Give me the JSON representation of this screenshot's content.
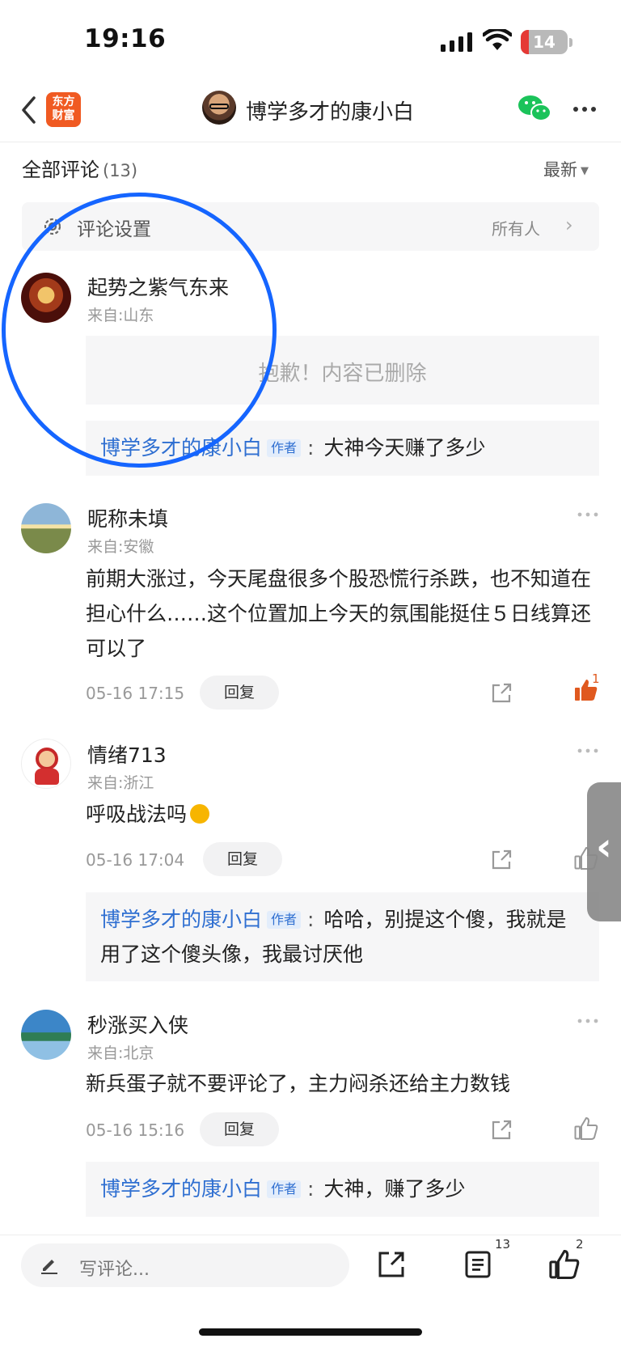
{
  "status_bar": {
    "time": "19:16",
    "battery": "14"
  },
  "nav": {
    "app_logo": "东方\n财富",
    "title": "博学多才的康小白",
    "back_icon": "chevron-left-icon",
    "share_icon": "wechat-icon",
    "more_icon": "more-icon"
  },
  "section": {
    "title": "全部评论",
    "count": "(13)",
    "sort": "最新"
  },
  "settings": {
    "label": "评论设置",
    "value": "所有人"
  },
  "comments": [
    {
      "name": "起势之紫气东来",
      "location": "来自:山东",
      "deleted_text": "抱歉！内容已删除",
      "reply": {
        "author": "博学多才的康小白",
        "tag": "作者",
        "colon": ":",
        "text": "大神今天赚了多少"
      }
    },
    {
      "name": "昵称未填",
      "location": "来自:安徽",
      "content": "前期大涨过，今天尾盘很多个股恐慌行杀跌，也不知道在担心什么……这个位置加上今天的氛围能挺住５日线算还可以了",
      "time": "05-16 17:15",
      "reply_label": "回复",
      "like_count": "1"
    },
    {
      "name": "情绪713",
      "location": "来自:浙江",
      "content": "呼吸战法吗",
      "time": "05-16 17:04",
      "reply_label": "回复",
      "reply": {
        "author": "博学多才的康小白",
        "tag": "作者",
        "colon": ":",
        "text": "哈哈，别提这个傻，我就是用了这个傻头像，我最讨厌他"
      }
    },
    {
      "name": "秒涨买入侠",
      "location": "来自:北京",
      "content": "新兵蛋子就不要评论了，主力闷杀还给主力数钱",
      "time": "05-16 15:16",
      "reply_label": "回复",
      "reply": {
        "author": "博学多才的康小白",
        "tag": "作者",
        "colon": ":",
        "text": "大神，赚了多少"
      }
    }
  ],
  "bottom_bar": {
    "placeholder": "写评论...",
    "comment_count": "13",
    "like_count": "2"
  },
  "colors": {
    "accent_blue": "#2f6fd1",
    "like_orange": "#e0591f",
    "annotation_blue": "#1565ff",
    "brand_orange": "#f05a22"
  }
}
